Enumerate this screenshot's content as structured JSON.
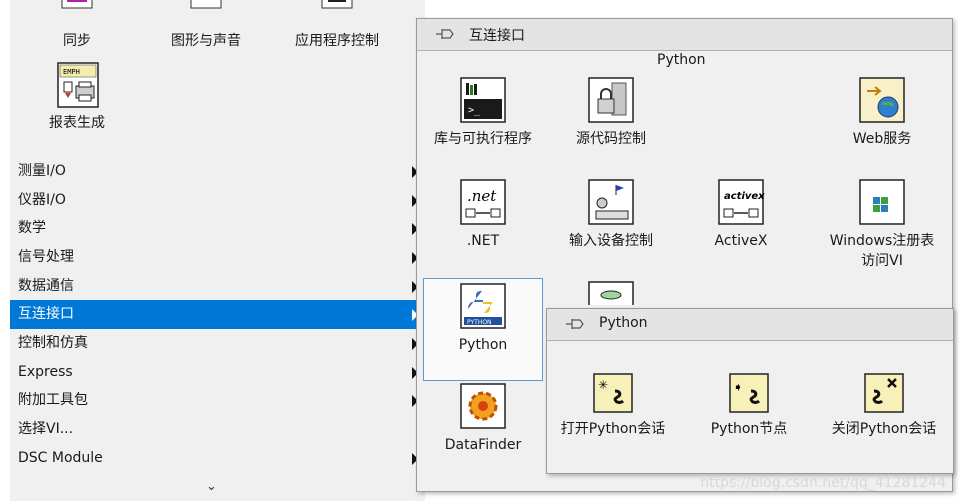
{
  "palette": {
    "top_icons": [
      {
        "label": "同步",
        "icon": "sync-icon"
      },
      {
        "label": "图形与声音",
        "icon": "graphics-sound-icon"
      },
      {
        "label": "应用程序控制",
        "icon": "app-control-icon"
      },
      {
        "label": "报表生成",
        "icon": "report-generation-icon"
      }
    ],
    "categories": [
      "测量I/O",
      "仪器I/O",
      "数学",
      "信号处理",
      "数据通信",
      "互连接口",
      "控制和仿真",
      "Express",
      "附加工具包",
      "选择VI...",
      "DSC Module"
    ],
    "selected_category": "互连接口",
    "more": "⌄"
  },
  "interconnect": {
    "title": "互连接口",
    "section_title": "Python",
    "items": [
      "库与可执行程序",
      "源代码控制",
      "Web服务",
      ".NET",
      "输入设备控制",
      "ActiveX",
      "Windows注册表访问VI",
      "Python",
      "DataFinder"
    ]
  },
  "python_panel": {
    "title": "Python",
    "items": [
      "打开Python会话",
      "Python节点",
      "关闭Python会话"
    ]
  },
  "watermark": "https://blog.csdn.net/qq_41281244",
  "colors": {
    "selection": "#0078d7",
    "panel_bg": "#f0f0f0",
    "header_bg": "#e4e4e4"
  }
}
